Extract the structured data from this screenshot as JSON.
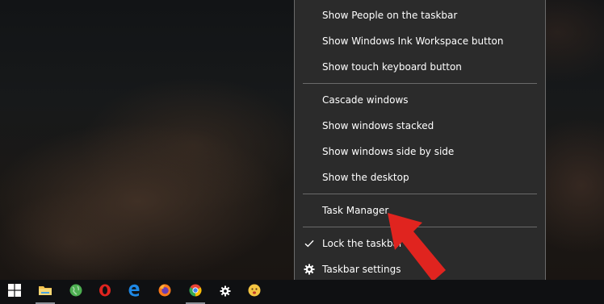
{
  "context_menu": {
    "items": [
      {
        "label": "Show People on the taskbar"
      },
      {
        "label": "Show Windows Ink Workspace button"
      },
      {
        "label": "Show touch keyboard button"
      },
      {
        "label": "Cascade windows"
      },
      {
        "label": "Show windows stacked"
      },
      {
        "label": "Show windows side by side"
      },
      {
        "label": "Show the desktop"
      },
      {
        "label": "Task Manager",
        "highlighted_by": "red-arrow"
      },
      {
        "label": "Lock the taskbar",
        "checked": true,
        "glyph": "checkmark-icon"
      },
      {
        "label": "Taskbar settings",
        "glyph": "gear-icon"
      }
    ]
  },
  "taskbar": {
    "icons": [
      {
        "name": "windows-start-icon",
        "color": "#ffffff"
      },
      {
        "name": "file-explorer-icon",
        "color": "#f2c14e"
      },
      {
        "name": "globe-app-icon",
        "color": "#4caf50"
      },
      {
        "name": "opera-icon",
        "color": "#e0241f"
      },
      {
        "name": "edge-icon",
        "color": "#1e88e5"
      },
      {
        "name": "firefox-icon",
        "color": "#ff7a1a"
      },
      {
        "name": "chrome-icon",
        "color": "#34a853"
      },
      {
        "name": "settings-gear-icon",
        "color": "#ffffff"
      },
      {
        "name": "emoji-app-icon",
        "color": "#f5c542"
      }
    ]
  },
  "annotation": {
    "arrow_color": "#e0241f"
  }
}
